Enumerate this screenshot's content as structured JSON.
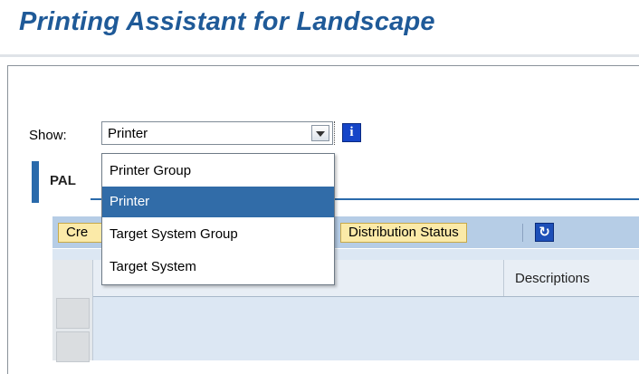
{
  "page": {
    "title": "Printing Assistant for Landscape"
  },
  "filter": {
    "show_label": "Show:",
    "selected_value": "Printer",
    "options": [
      "Printer Group",
      "Printer",
      "Target System Group",
      "Target System"
    ],
    "selected_index": 1
  },
  "tab": {
    "label": "PAL"
  },
  "toolbar": {
    "create_label": "Cre",
    "distribution_status_label": "Distribution Status"
  },
  "table": {
    "columns": [
      "",
      "Descriptions"
    ]
  },
  "icons": {
    "info": "info-icon",
    "refresh": "refresh-icon",
    "dropdown": "chevron-down-icon"
  },
  "colors": {
    "title": "#1f5a98",
    "selection": "#316ca8",
    "toolbar": "#b6cde6",
    "button": "#fbeaa8"
  }
}
